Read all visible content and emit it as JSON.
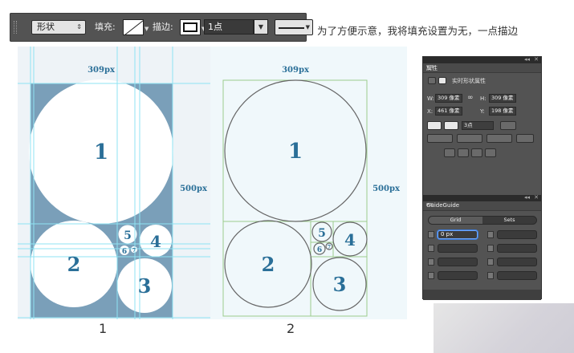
{
  "toolbar": {
    "shape_mode": "形状",
    "fill_label": "填充:",
    "stroke_label": "描边:",
    "stroke_width": "1点"
  },
  "caption": "为了方便示意，我将填充设置为无，一点描边",
  "diagram1": {
    "width_label": "309px",
    "height_label": "500px",
    "numbers": [
      "1",
      "2",
      "3",
      "4",
      "5",
      "6",
      "7"
    ],
    "figure_label": "1",
    "colors": {
      "background": "#7a9fb9",
      "circle": "#ffffff",
      "number": "#2a6f98",
      "guide": "#8fe3f3",
      "canvas": "#eef3f7"
    }
  },
  "diagram2": {
    "width_label": "309px",
    "height_label": "500px",
    "numbers": [
      "1",
      "2",
      "3",
      "4",
      "5",
      "6",
      "7"
    ],
    "figure_label": "2",
    "colors": {
      "background": "#f0f8fb",
      "circle_stroke": "#666666",
      "frame": "#9ccc8c",
      "number": "#2a6f98"
    }
  },
  "panel": {
    "properties_tab": "属性",
    "properties_title": "实时形状属性",
    "w_label": "W:",
    "w_value": "309 像素",
    "h_label": "H:",
    "h_value": "309 像素",
    "x_label": "X:",
    "x_value": "461 像素",
    "y_label": "Y:",
    "y_value": "198 像素",
    "stroke_pt": "3点",
    "guideguide_tab": "GuideGuide",
    "grid_tab": "Grid",
    "sets_tab": "Sets",
    "field_value": "0 px"
  }
}
